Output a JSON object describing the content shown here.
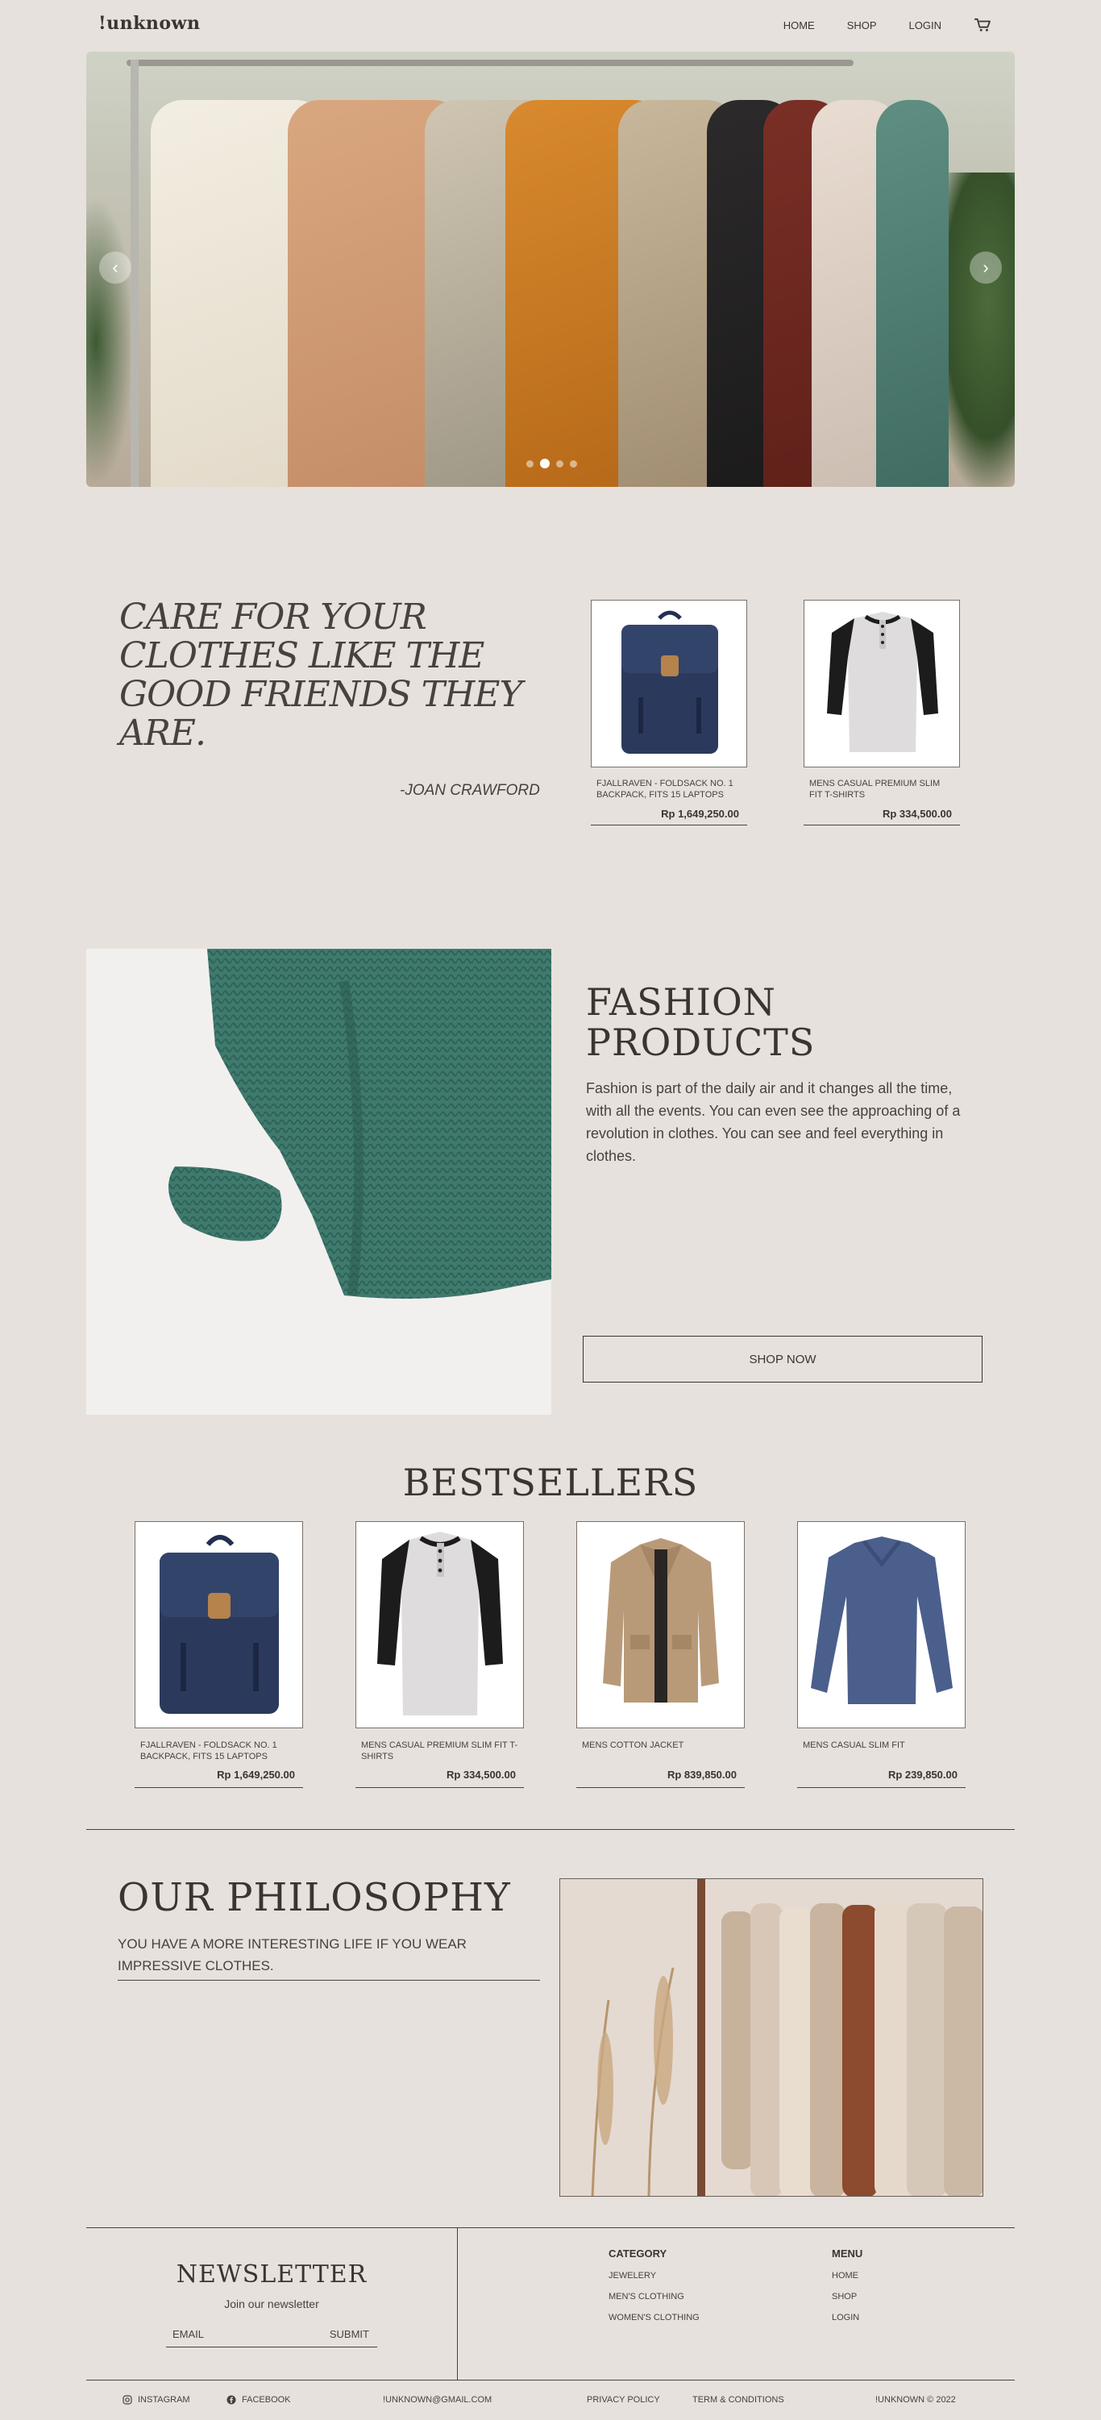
{
  "header": {
    "logo": "!unknown",
    "nav": [
      "HOME",
      "SHOP",
      "LOGIN"
    ]
  },
  "hero": {
    "prev": "‹",
    "next": "›",
    "slide_count": 4,
    "active_slide": 2
  },
  "quote": {
    "text": "CARE FOR YOUR CLOTHES LIKE THE GOOD FRIENDS THEY ARE.",
    "author": "-JOAN CRAWFORD"
  },
  "featured": [
    {
      "title": "FJALLRAVEN - FOLDSACK NO. 1 BACKPACK, FITS 15 LAPTOPS",
      "price": "Rp 1,649,250.00"
    },
    {
      "title": "MENS CASUAL PREMIUM SLIM FIT T-SHIRTS",
      "price": "Rp 334,500.00"
    }
  ],
  "fashion": {
    "title_line1": "FASHION",
    "title_line2": "PRODUCTS",
    "text": "Fashion is part of the daily air and it changes all the time, with all the events. You can even see the approaching of a revolution in clothes. You can see and feel everything in clothes.",
    "button": "SHOP NOW"
  },
  "bestsellers": {
    "title": "BESTSELLERS",
    "items": [
      {
        "title": "FJALLRAVEN - FOLDSACK NO. 1 BACKPACK, FITS 15 LAPTOPS",
        "price": "Rp 1,649,250.00"
      },
      {
        "title": "MENS CASUAL PREMIUM SLIM FIT T-SHIRTS",
        "price": "Rp 334,500.00"
      },
      {
        "title": "MENS COTTON JACKET",
        "price": "Rp 839,850.00"
      },
      {
        "title": "MENS CASUAL SLIM FIT",
        "price": "Rp 239,850.00"
      }
    ]
  },
  "philosophy": {
    "title": "OUR PHILOSOPHY",
    "text": "YOU HAVE A MORE INTERESTING LIFE IF YOU WEAR IMPRESSIVE CLOTHES."
  },
  "newsletter": {
    "title": "NEWSLETTER",
    "subtitle": "Join our newsletter",
    "email_placeholder": "EMAIL",
    "submit": "SUBMIT"
  },
  "footer": {
    "category_title": "CATEGORY",
    "categories": [
      "JEWELERY",
      "MEN'S CLOTHING",
      "WOMEN'S CLOTHING"
    ],
    "menu_title": "MENU",
    "menu": [
      "HOME",
      "SHOP",
      "LOGIN"
    ],
    "instagram": "INSTAGRAM",
    "facebook": "FACEBOOK",
    "email": "!UNKNOWN@GMAIL.COM",
    "privacy": "PRIVACY POLICY",
    "terms": "TERM & CONDITIONS",
    "copyright": "!UNKNOWN © 2022"
  },
  "colors": {
    "background": "#e6e1dd",
    "text": "#3b3430"
  }
}
